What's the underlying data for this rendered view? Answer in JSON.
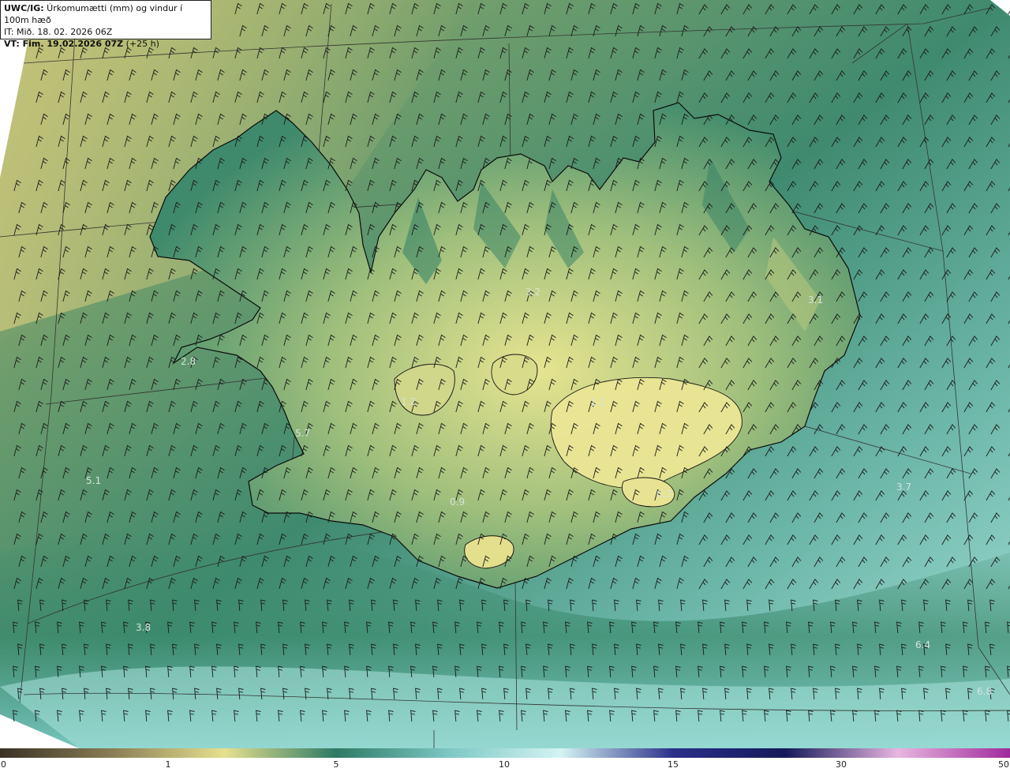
{
  "header": {
    "line1_bold": "UWC/IG:",
    "line1_rest": " Úrkomumætti (mm) og vindur í 100m hæð",
    "line2": "IT: Mið. 18. 02. 2026 06Z",
    "line3_bold": "VT: Fim. 19.02.2026 07Z",
    "line3_rest": " (+25 h)"
  },
  "value_labels": [
    {
      "text": "3.2"
    },
    {
      "text": "3.1"
    },
    {
      "text": "2.8"
    },
    {
      "text": "1.2"
    },
    {
      "text": "1.1"
    },
    {
      "text": "5.7"
    },
    {
      "text": "5.1"
    },
    {
      "text": "3.7"
    },
    {
      "text": "0.9"
    },
    {
      "text": "0.2"
    },
    {
      "text": "3.8"
    },
    {
      "text": "6.4"
    },
    {
      "text": "6.8"
    }
  ],
  "colorbar": {
    "ticks": [
      "0",
      "1",
      "5",
      "10",
      "15",
      "30",
      "50"
    ],
    "stops": [
      "#3a3126",
      "#8a7d55",
      "#e6e08e",
      "#2e7a64",
      "#7cc7c4",
      "#d4f3f3",
      "#2a2f8a",
      "#151a5a",
      "#e8b6e0",
      "#a02a9c"
    ]
  },
  "colors": {
    "sea_low": "#8bb36d",
    "sea_mid": "#3e8a6e",
    "sea_high": "#9ed9cf",
    "land": "#e0e08a",
    "coast": "#000000"
  }
}
